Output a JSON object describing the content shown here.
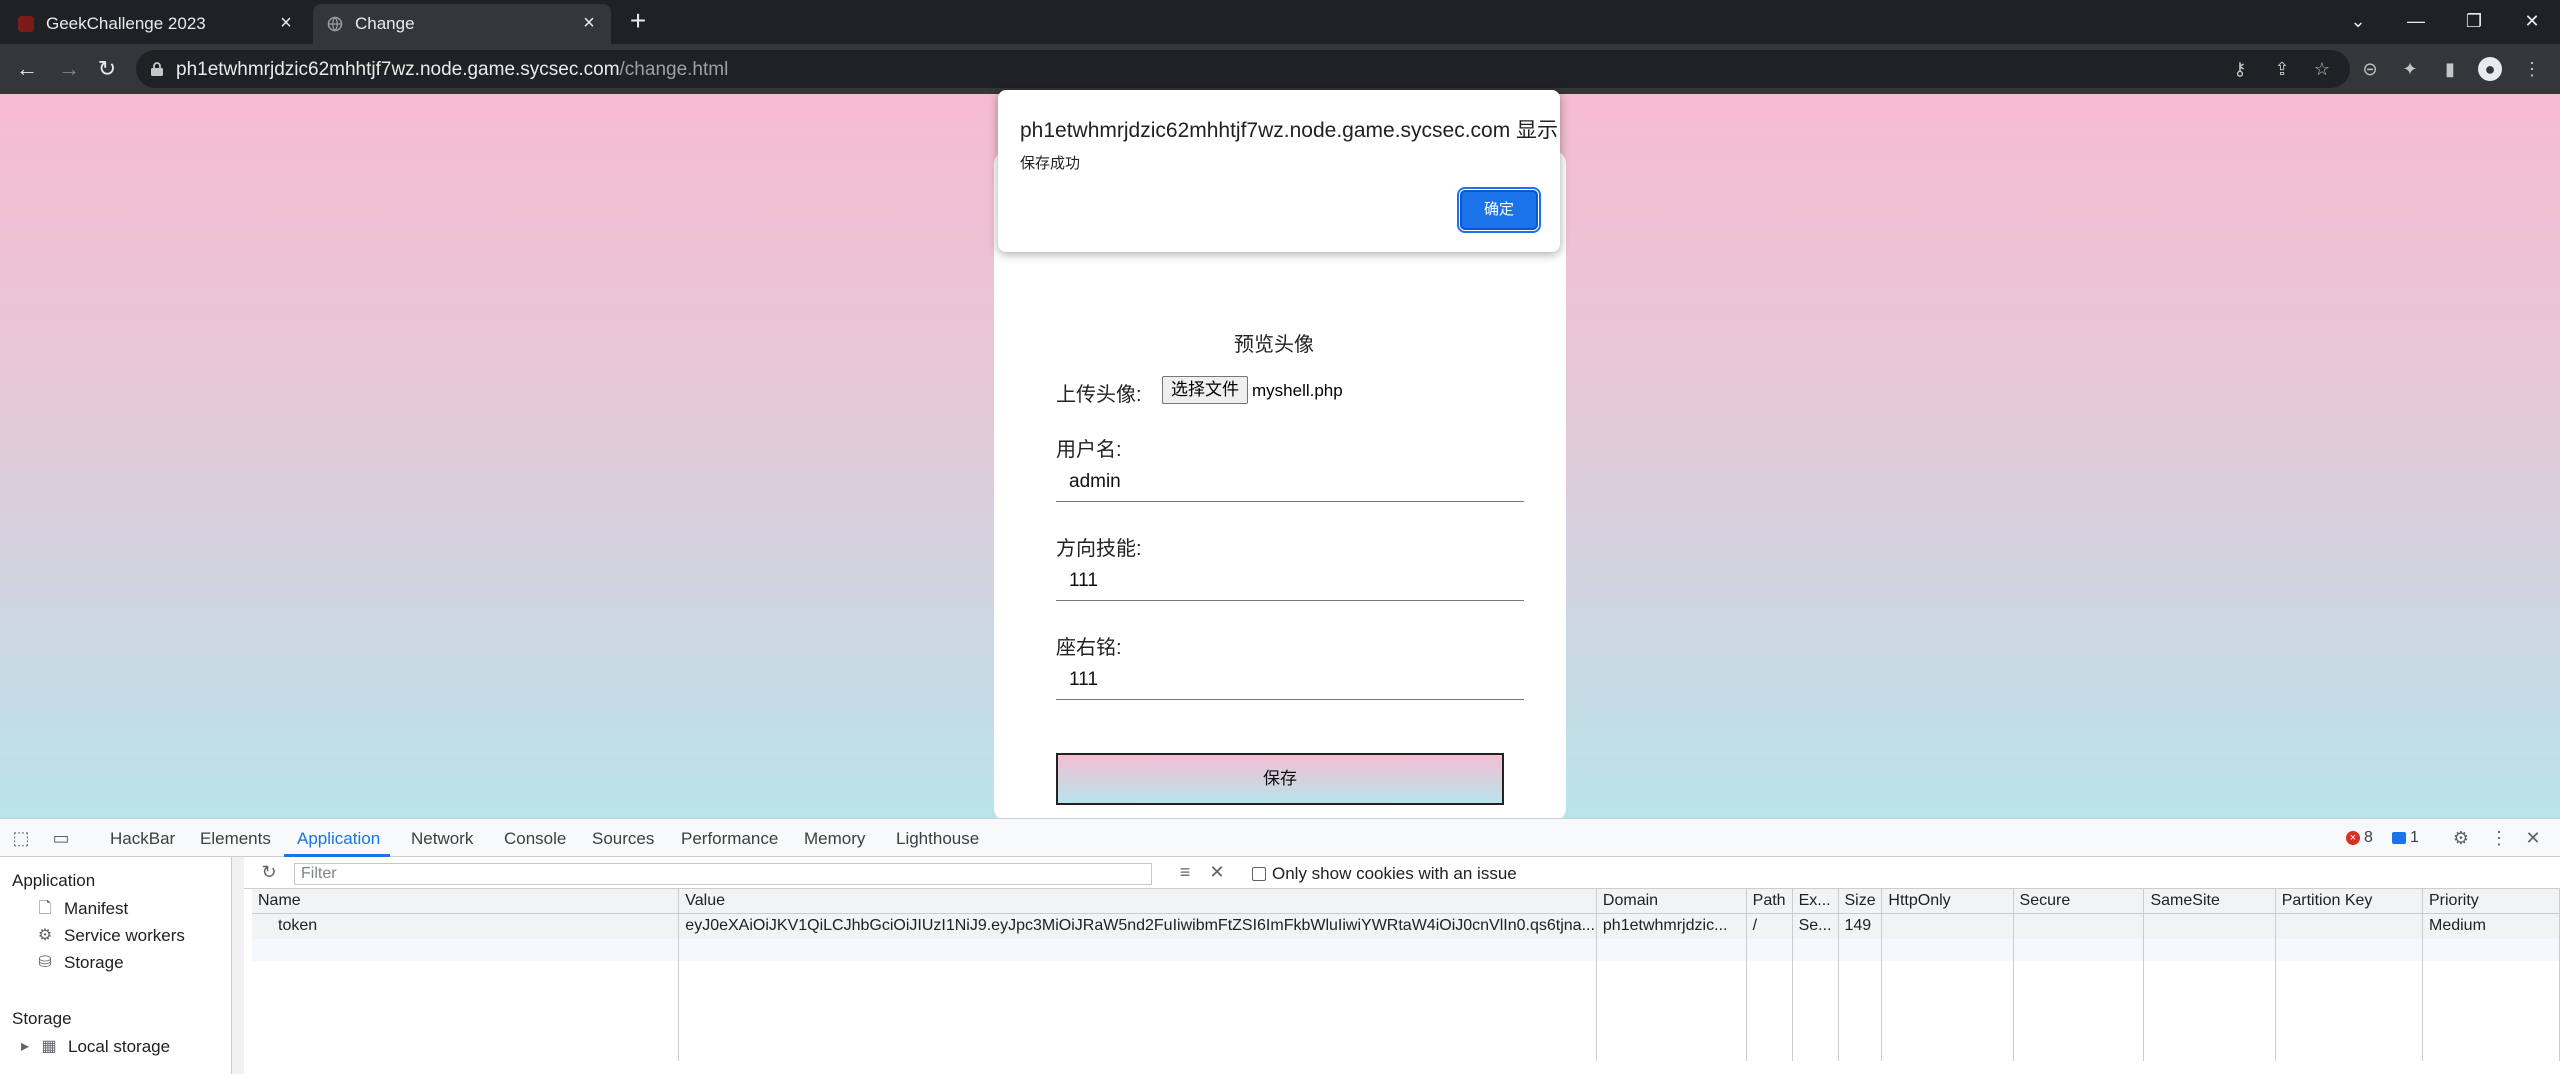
{
  "browser": {
    "tabs": [
      {
        "title": "GeekChallenge 2023",
        "active": false
      },
      {
        "title": "Change",
        "active": true
      }
    ],
    "url_host": "ph1etwhmrjdzic62mhhtjf7wz.node.game.sycsec.com",
    "url_path": "/change.html"
  },
  "page": {
    "preview_alt": "预览头像",
    "upload_label": "上传头像:",
    "file_button": "选择文件",
    "file_name": "myshell.php",
    "username_label": "用户名:",
    "username_value": "admin",
    "skill_label": "方向技能:",
    "skill_value": "111",
    "motto_label": "座右铭:",
    "motto_value": "111",
    "save_button": "保存"
  },
  "dialog": {
    "origin": "ph1etwhmrjdzic62mhhtjf7wz.node.game.sycsec.com 显示",
    "message": "保存成功",
    "ok_button": "确定"
  },
  "devtools": {
    "tabs": [
      "HackBar",
      "Elements",
      "Application",
      "Network",
      "Console",
      "Sources",
      "Performance",
      "Memory",
      "Lighthouse"
    ],
    "active_tab": "Application",
    "errors": "8",
    "messages": "1",
    "sidebar": {
      "application_header": "Application",
      "items": [
        "Manifest",
        "Service workers",
        "Storage"
      ],
      "storage_header": "Storage",
      "storage_items": [
        "Local storage"
      ]
    },
    "filter_placeholder": "Filter",
    "only_issue_label": "Only show cookies with an issue",
    "columns": [
      "Name",
      "Value",
      "Domain",
      "Path",
      "Ex...",
      "Size",
      "HttpOnly",
      "Secure",
      "SameSite",
      "Partition Key",
      "Priority"
    ],
    "rows": [
      {
        "name": "token",
        "value": "eyJ0eXAiOiJKV1QiLCJhbGciOiJIUzI1NiJ9.eyJpc3MiOiJRaW5nd2FuIiwibmFtZSI6ImFkbWluIiwiYWRtaW4iOiJ0cnVlIn0.qs6tjna...",
        "domain": "ph1etwhmrjdzic...",
        "path": "/",
        "expires": "Se...",
        "size": "149",
        "httponly": "",
        "secure": "",
        "samesite": "",
        "partition_key": "",
        "priority": "Medium"
      }
    ]
  }
}
